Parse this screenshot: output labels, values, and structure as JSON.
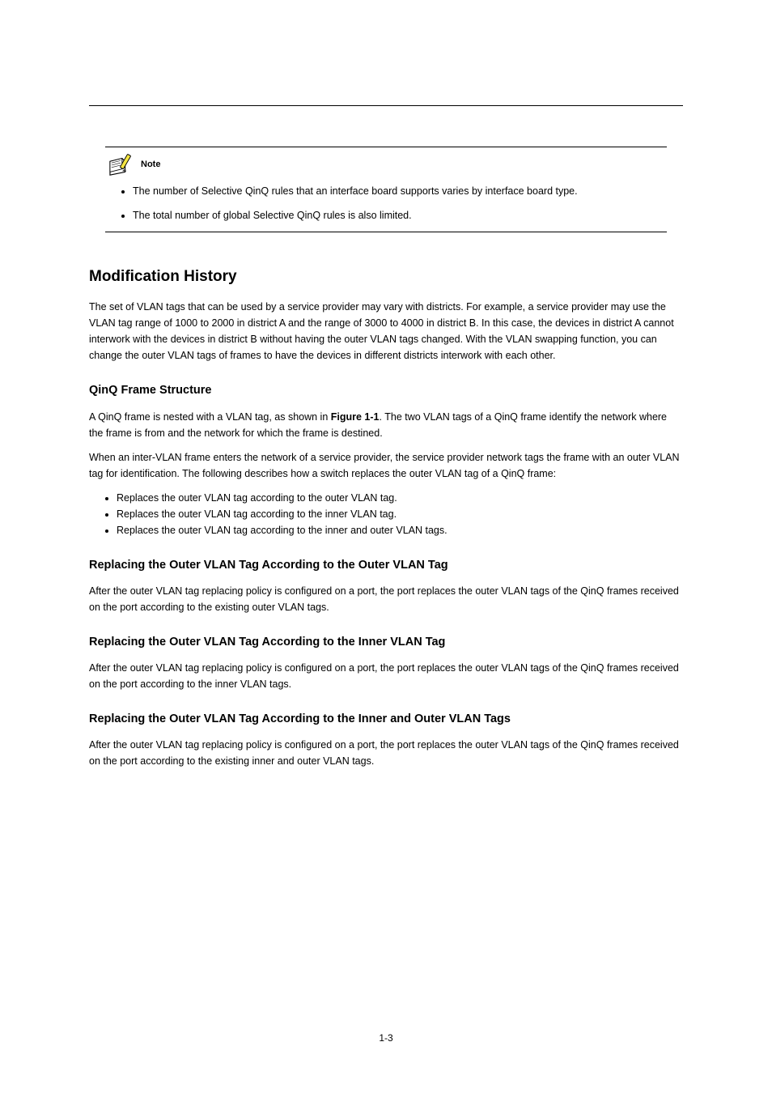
{
  "note": {
    "label": "Note",
    "items": [
      "The number of Selective QinQ rules that an interface board supports varies by interface board type.",
      "The total number of global Selective QinQ rules is also limited."
    ]
  },
  "section": {
    "title": "Modification History",
    "intro": "The set of VLAN tags that can be used by a service provider may vary with districts. For example, a service provider may use the VLAN tag range of 1000 to 2000 in district A and the range of 3000 to 4000 in district B. In this case, the devices in district A cannot interwork with the devices in district B without having the outer VLAN tags changed. With the VLAN swapping function, you can change the outer VLAN tags of frames to have the devices in different districts interwork with each other.",
    "sub1": {
      "heading": "QinQ Frame Structure",
      "p1_prefix": "A QinQ frame is nested with a VLAN tag, as shown in ",
      "p1_link": "Figure 1-1",
      "p1_suffix": ". The two VLAN tags of a QinQ frame identify the network where the frame is from and the network for which the frame is destined.",
      "p2": "When an inter-VLAN frame enters the network of a service provider, the service provider network tags the frame with an outer VLAN tag for identification. The following describes how a switch replaces the outer VLAN tag of a QinQ frame:",
      "bullets": [
        "Replaces the outer VLAN tag according to the outer VLAN tag.",
        "Replaces the outer VLAN tag according to the inner VLAN tag.",
        "Replaces the outer VLAN tag according to the inner and outer VLAN tags."
      ]
    },
    "sub2": {
      "heading": "Replacing the Outer VLAN Tag According to the Outer VLAN Tag",
      "p": "After the outer VLAN tag replacing policy is configured on a port, the port replaces the outer VLAN tags of the QinQ frames received on the port according to the existing outer VLAN tags."
    },
    "sub3": {
      "heading": "Replacing the Outer VLAN Tag According to the Inner VLAN Tag",
      "p": "After the outer VLAN tag replacing policy is configured on a port, the port replaces the outer VLAN tags of the QinQ frames received on the port according to the inner VLAN tags."
    },
    "sub4": {
      "heading": "Replacing the Outer VLAN Tag According to the Inner and Outer VLAN Tags",
      "p": "After the outer VLAN tag replacing policy is configured on a port, the port replaces the outer VLAN tags of the QinQ frames received on the port according to the existing inner and outer VLAN tags."
    }
  },
  "pageNumber": "1-3"
}
